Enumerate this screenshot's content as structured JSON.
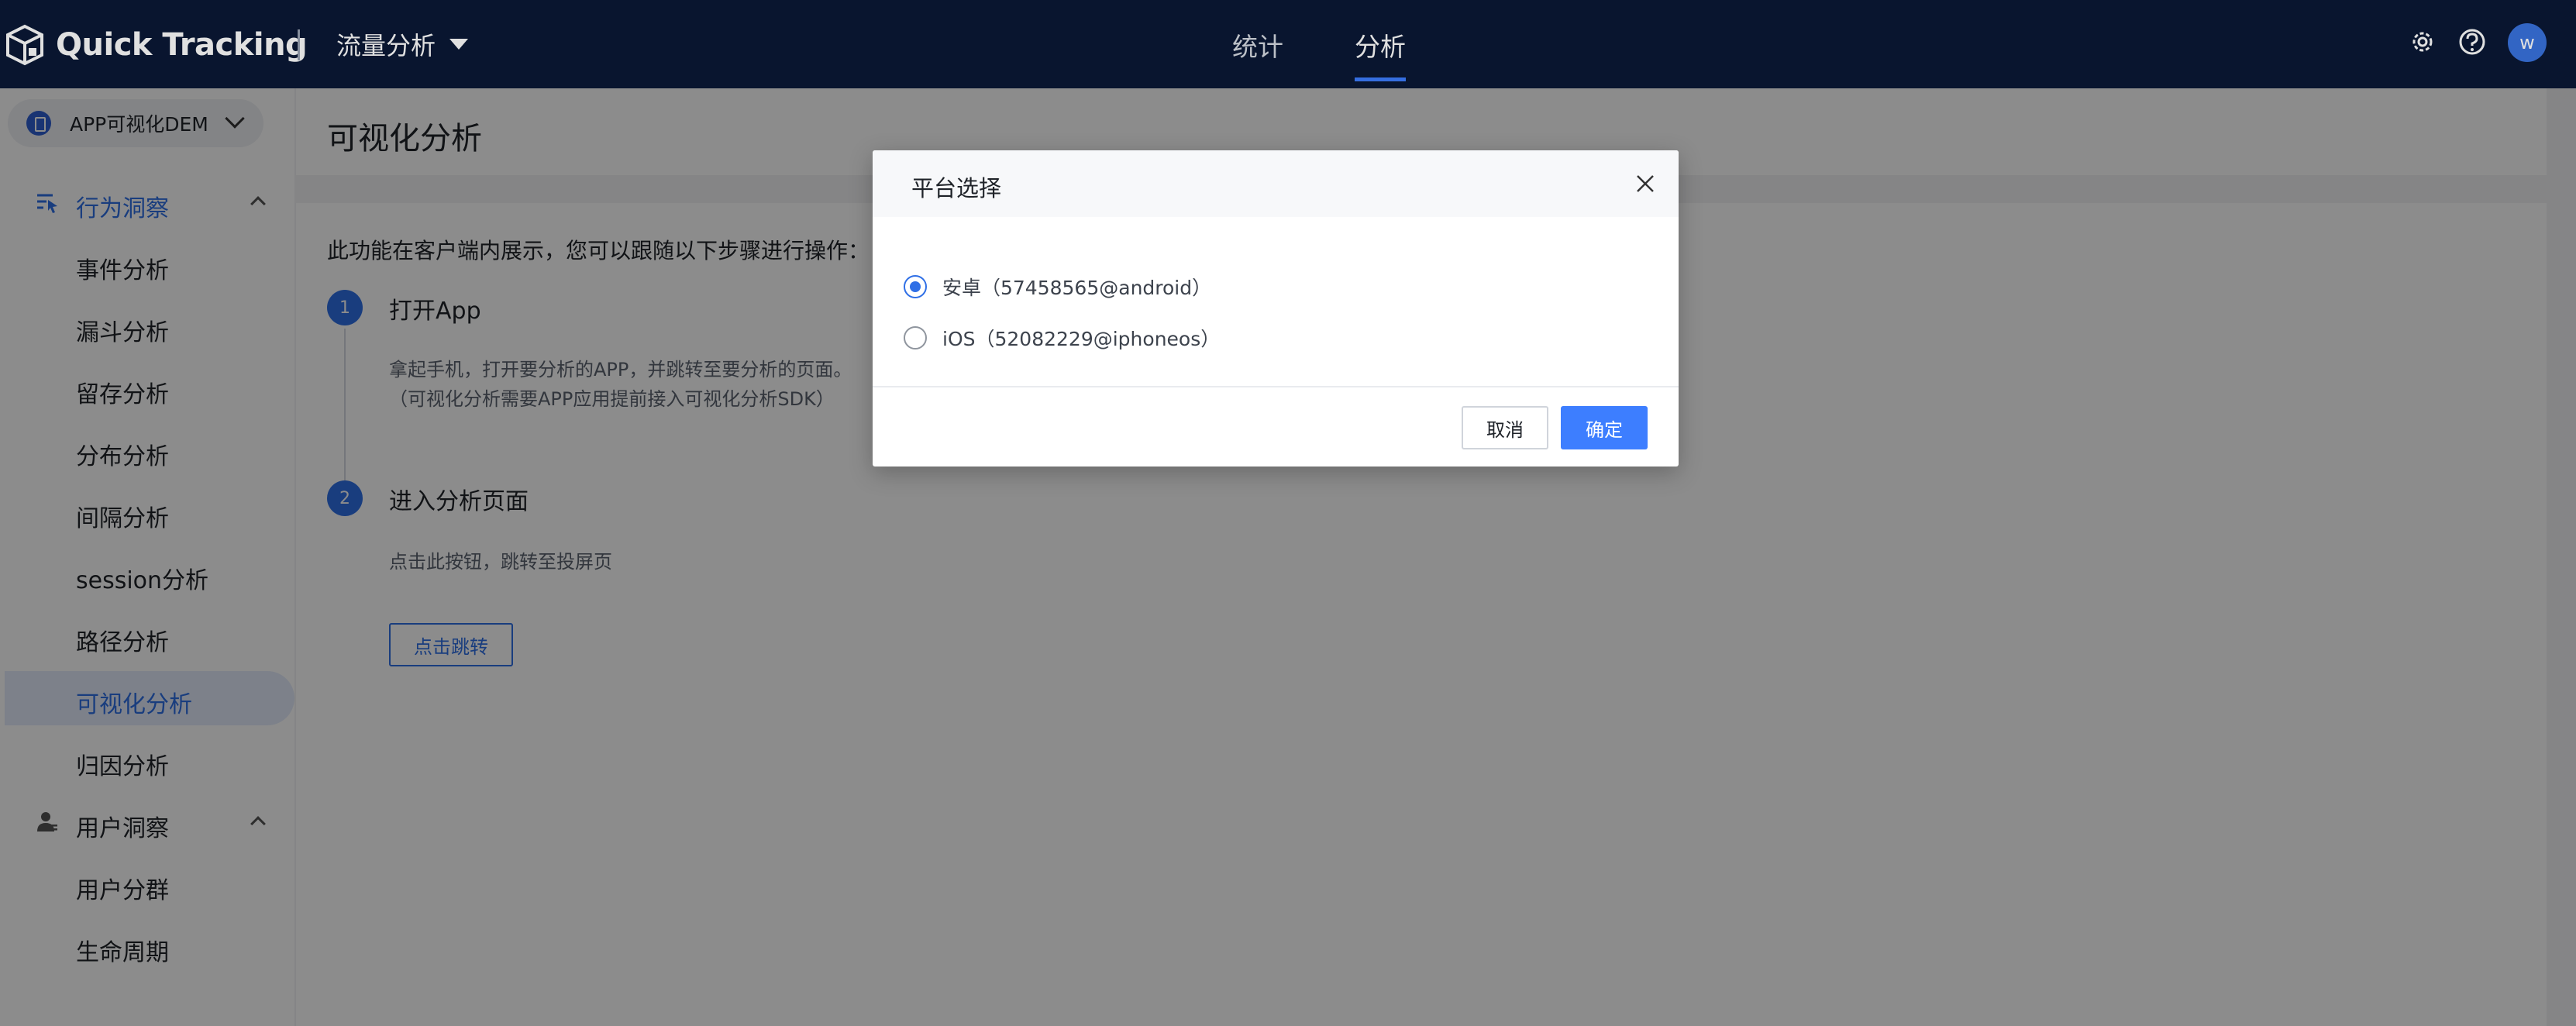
{
  "header": {
    "logo_text": "Quick Tracking",
    "product_label": "流量分析",
    "nav": [
      {
        "label": "统计",
        "active": false
      },
      {
        "label": "分析",
        "active": true
      }
    ],
    "icons": [
      "gear-icon",
      "help-icon"
    ],
    "avatar_letter": "w"
  },
  "sidebar": {
    "app_name": "APP可视化DEM",
    "groups": [
      {
        "label": "行为洞察",
        "icon": "behavior-insight-icon",
        "expanded": true,
        "items": [
          {
            "label": "事件分析",
            "active": false
          },
          {
            "label": "漏斗分析",
            "active": false
          },
          {
            "label": "留存分析",
            "active": false
          },
          {
            "label": "分布分析",
            "active": false
          },
          {
            "label": "间隔分析",
            "active": false
          },
          {
            "label": "session分析",
            "active": false
          },
          {
            "label": "路径分析",
            "active": false
          },
          {
            "label": "可视化分析",
            "active": true
          },
          {
            "label": "归因分析",
            "active": false
          }
        ]
      },
      {
        "label": "用户洞察",
        "icon": "user-insight-icon",
        "expanded": true,
        "items": [
          {
            "label": "用户分群",
            "active": false
          },
          {
            "label": "生命周期",
            "active": false
          }
        ]
      }
    ]
  },
  "main": {
    "page_title": "可视化分析",
    "intro": "此功能在客户端内展示，您可以跟随以下步骤进行操作：",
    "steps": [
      {
        "number": "1",
        "title": "打开App",
        "desc_lines": [
          "拿起手机，打开要分析的APP，并跳转至要分析的页面。",
          "（可视化分析需要APP应用提前接入可视化分析SDK）"
        ]
      },
      {
        "number": "2",
        "title": "进入分析页面",
        "desc_lines": [
          "点击此按钮，跳转至投屏页"
        ],
        "button_label": "点击跳转"
      }
    ]
  },
  "modal": {
    "title": "平台选择",
    "options": [
      {
        "label": "安卓（57458565@android）",
        "checked": true
      },
      {
        "label": "iOS（52082229@iphoneos）",
        "checked": false
      }
    ],
    "cancel_label": "取消",
    "ok_label": "确定"
  },
  "colors": {
    "topbar": "#0b1936",
    "accent": "#3d7eff",
    "active_text": "#2f6fe6"
  }
}
